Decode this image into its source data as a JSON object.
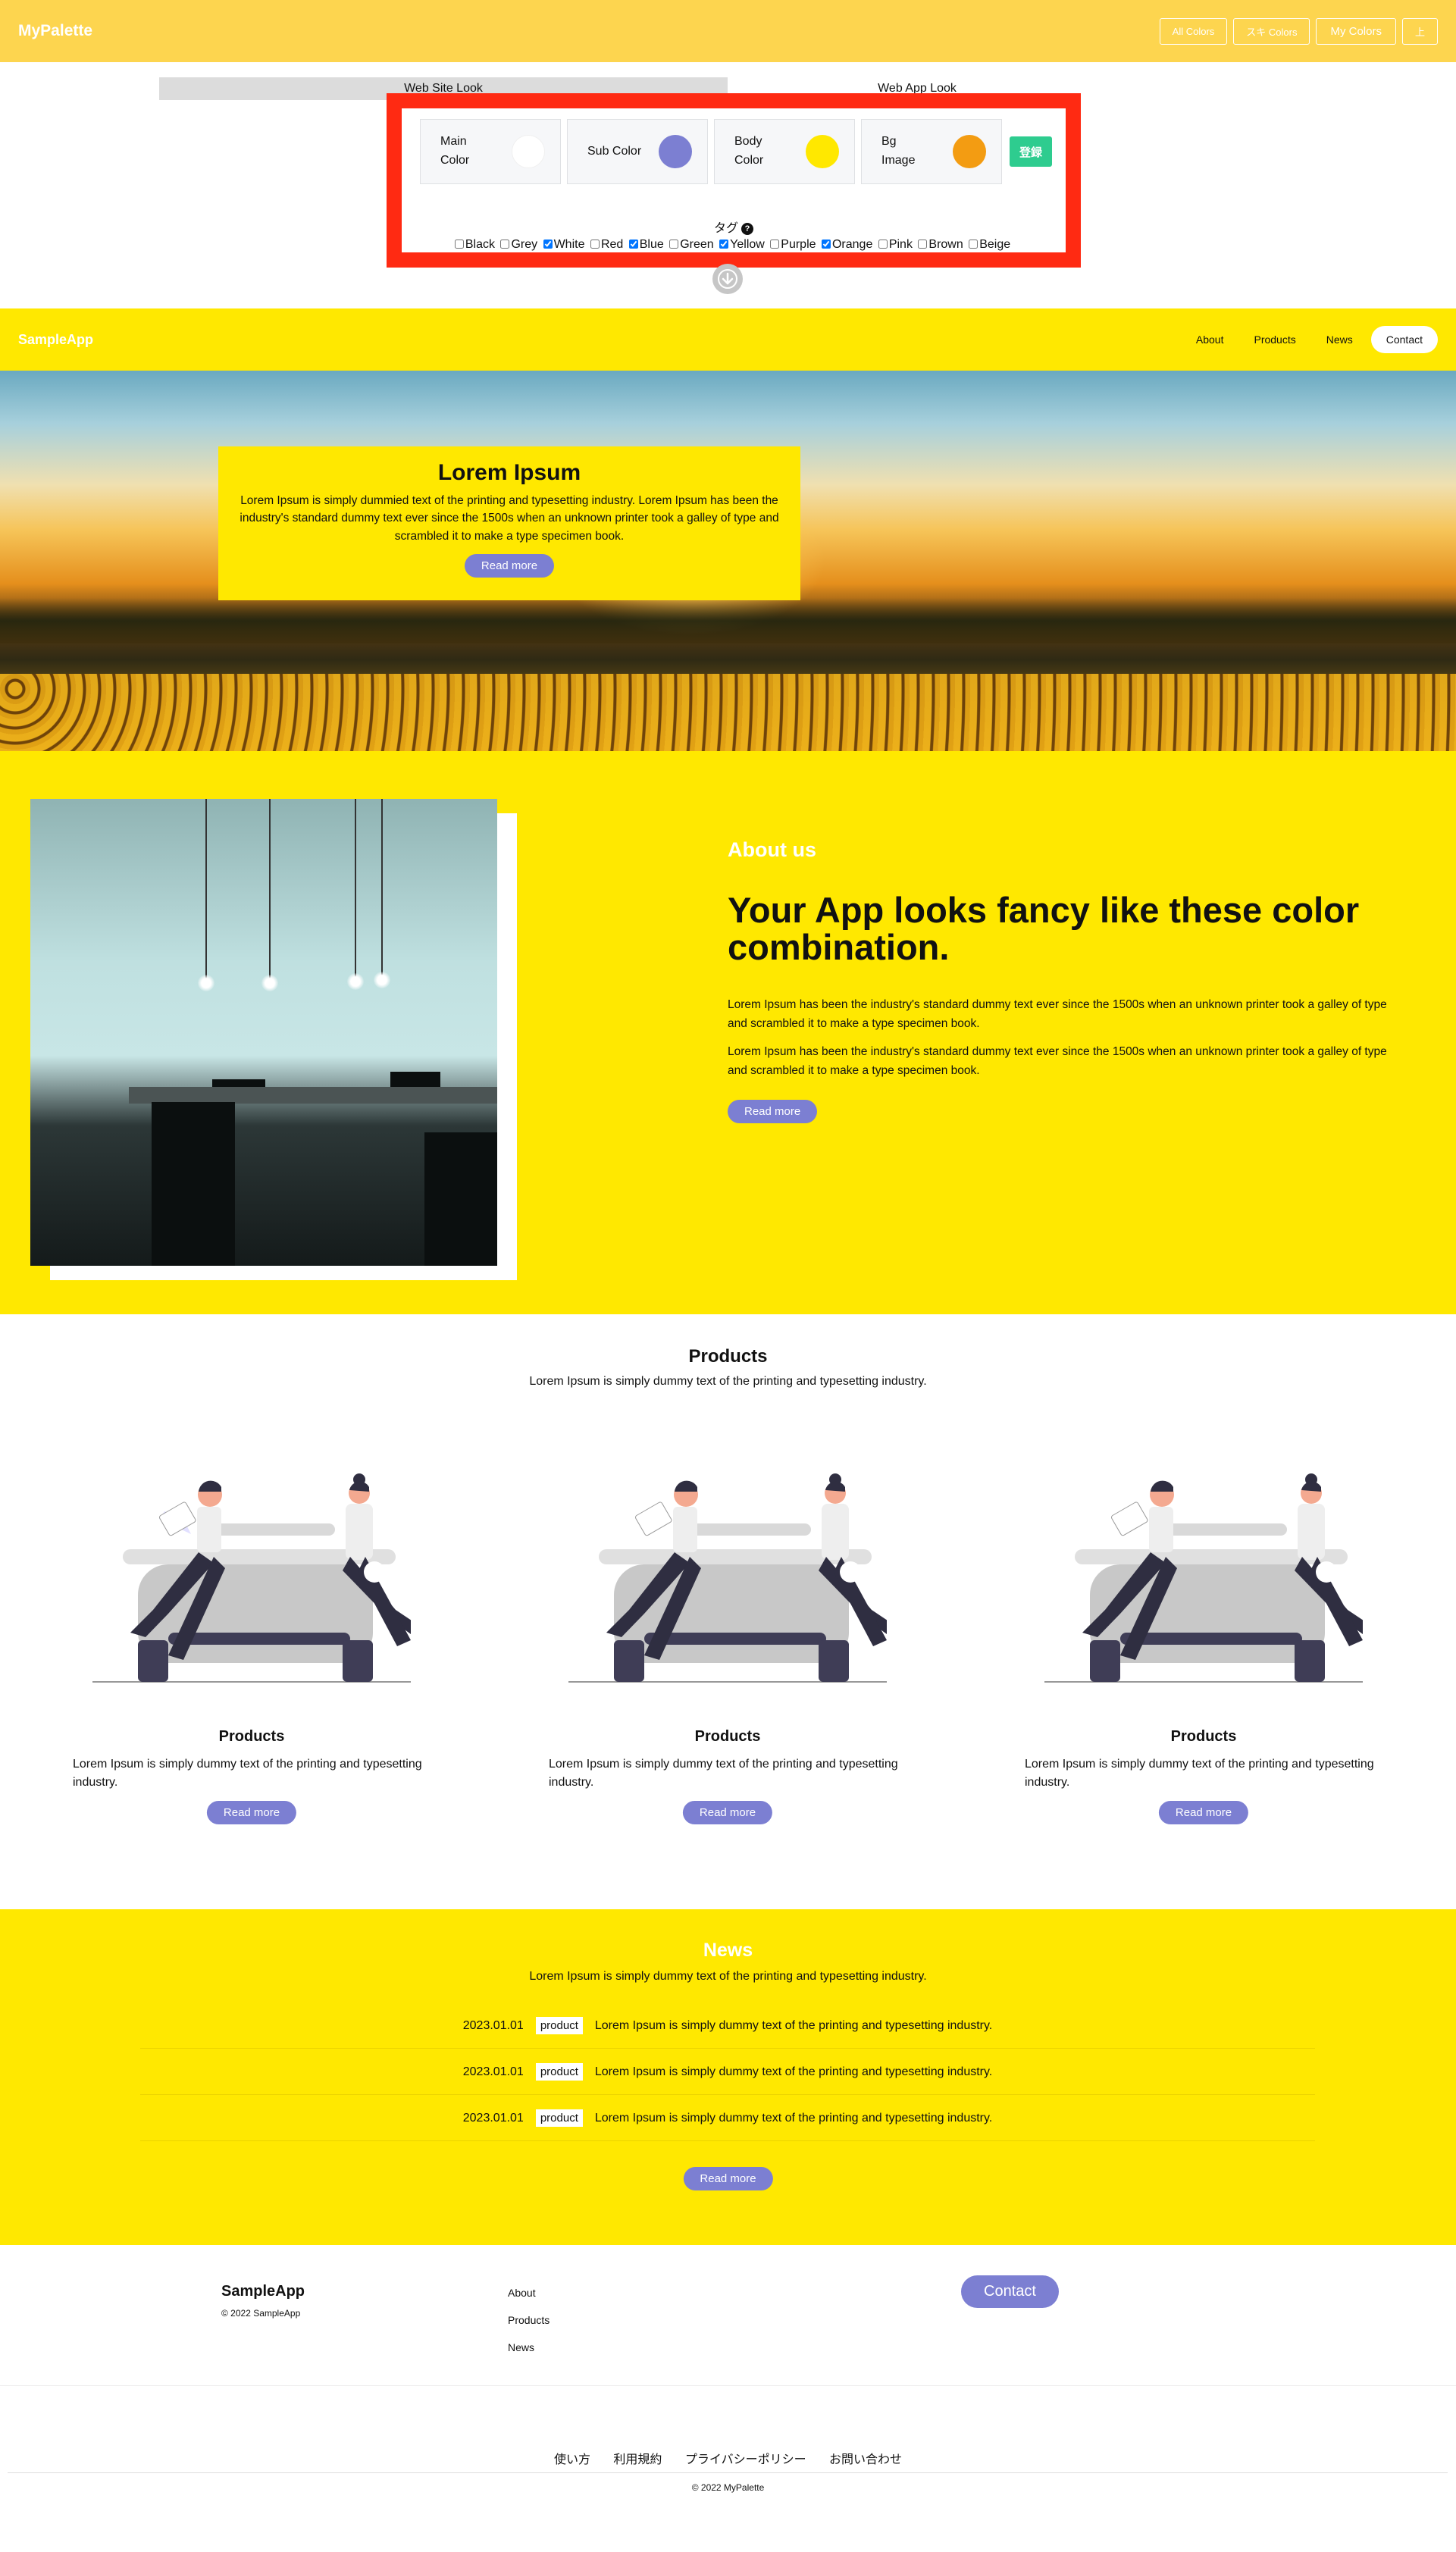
{
  "appbar": {
    "logo": "MyPalette",
    "nav": [
      "All Colors",
      "スキ Colors",
      "My Colors",
      "上"
    ]
  },
  "look": {
    "web": "Web Site Look",
    "app": "Web App Look"
  },
  "palette": {
    "swatches": [
      {
        "label": "Main\nColor",
        "color": "#ffffff"
      },
      {
        "label": "Sub Color",
        "color": "#7c7fd2"
      },
      {
        "label": "Body\nColor",
        "color": "#ffe800"
      },
      {
        "label": "Bg\nImage",
        "color": "#f39c12"
      }
    ],
    "register": "登録",
    "tag_title": "タグ",
    "help": "?",
    "tags": [
      {
        "label": "Black",
        "checked": false
      },
      {
        "label": "Grey",
        "checked": false
      },
      {
        "label": "White",
        "checked": true
      },
      {
        "label": "Red",
        "checked": false
      },
      {
        "label": "Blue",
        "checked": true
      },
      {
        "label": "Green",
        "checked": false
      },
      {
        "label": "Yellow",
        "checked": true
      },
      {
        "label": "Purple",
        "checked": false
      },
      {
        "label": "Orange",
        "checked": true
      },
      {
        "label": "Pink",
        "checked": false
      },
      {
        "label": "Brown",
        "checked": false
      },
      {
        "label": "Beige",
        "checked": false
      }
    ]
  },
  "sample": {
    "logo": "SampleApp",
    "nav": [
      "About",
      "Products",
      "News"
    ],
    "contact": "Contact",
    "hero": {
      "title": "Lorem Ipsum",
      "text": "Lorem Ipsum is simply dummied text of the printing and typesetting industry. Lorem Ipsum has been the industry's standard dummy text ever since the 1500s when an unknown printer took a galley of type and scrambled it to make a type specimen book.",
      "button": "Read more"
    },
    "about": {
      "label": "About us",
      "heading": "Your App looks fancy like these color combination.",
      "p1": "Lorem Ipsum has been the industry's standard dummy text ever since the 1500s when an unknown printer took a galley of type and scrambled it to make a type specimen book.",
      "p2": "Lorem Ipsum has been the industry's standard dummy text ever since the 1500s when an unknown printer took a galley of type and scrambled it to make a type specimen book.",
      "button": "Read more"
    },
    "products": {
      "title": "Products",
      "sub": "Lorem Ipsum is simply dummy text of the printing and typesetting industry.",
      "cards": [
        {
          "title": "Products",
          "text": "Lorem Ipsum is simply dummy text of the printing and typesetting industry.",
          "button": "Read more"
        },
        {
          "title": "Products",
          "text": "Lorem Ipsum is simply dummy text of the printing and typesetting industry.",
          "button": "Read more"
        },
        {
          "title": "Products",
          "text": "Lorem Ipsum is simply dummy text of the printing and typesetting industry.",
          "button": "Read more"
        }
      ]
    },
    "news": {
      "title": "News",
      "sub": "Lorem Ipsum is simply dummy text of the printing and typesetting industry.",
      "items": [
        {
          "date": "2023.01.01",
          "badge": "product",
          "text": "Lorem Ipsum is simply dummy text of the printing and typesetting industry."
        },
        {
          "date": "2023.01.01",
          "badge": "product",
          "text": "Lorem Ipsum is simply dummy text of the printing and typesetting industry."
        },
        {
          "date": "2023.01.01",
          "badge": "product",
          "text": "Lorem Ipsum is simply dummy text of the printing and typesetting industry."
        }
      ],
      "button": "Read more"
    },
    "footer": {
      "brand": "SampleApp",
      "copy": "© 2022 SampleApp",
      "links": [
        "About",
        "Products",
        "News"
      ],
      "contact": "Contact"
    }
  },
  "site_footer": {
    "links": [
      "使い方",
      "利用規約",
      "プライバシーポリシー",
      "お問い合わせ"
    ],
    "copy": "© 2022 MyPalette"
  },
  "colors": {
    "appbar": "#fdd54f",
    "body": "#ffe800",
    "accent": "#7c7fd2",
    "frame": "#ff2a12",
    "register": "#2ecc8f"
  }
}
